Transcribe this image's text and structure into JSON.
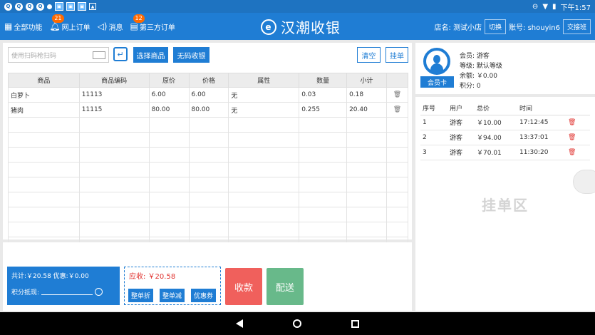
{
  "statusbar": {
    "time": "下午1:57"
  },
  "header": {
    "nav": [
      {
        "label": "全部功能",
        "badge": ""
      },
      {
        "label": "网上订单",
        "badge": "21"
      },
      {
        "label": "消息",
        "badge": ""
      },
      {
        "label": "第三方订单",
        "badge": "12"
      }
    ],
    "brand": "汉潮收银",
    "store_label": "店名: 测试小店",
    "switch_label": "切换",
    "account_label": "账号: shouyin6",
    "handover_label": "交接班"
  },
  "toolbar": {
    "scan_placeholder": "使用扫码枪扫码",
    "select_goods": "选择商品",
    "no_code": "无码收银",
    "clear": "清空",
    "hang": "挂单"
  },
  "goods_table": {
    "headers": [
      "商品",
      "商品编码",
      "原价",
      "价格",
      "属性",
      "数量",
      "小计"
    ],
    "rows": [
      [
        "白萝卜",
        "11113",
        "6.00",
        "6.00",
        "无",
        "0.03",
        "0.18"
      ],
      [
        "猪肉",
        "11115",
        "80.00",
        "80.00",
        "无",
        "0.255",
        "20.40"
      ]
    ]
  },
  "totals": {
    "summary": "共计:￥20.58  优惠:￥0.00",
    "points_label": "积分抵现:",
    "due": "应收: ￥20.58",
    "discount_btn": "整单折",
    "reduce_btn": "整单减",
    "coupon_btn": "优惠券",
    "pay": "收款",
    "deliver": "配送"
  },
  "member": {
    "card_btn": "会员卡",
    "name": "会员: 游客",
    "level": "等级: 默认等级",
    "balance": "余额: ￥0.00",
    "points": "积分: 0"
  },
  "pending": {
    "headers": [
      "序号",
      "用户",
      "总价",
      "时间"
    ],
    "rows": [
      [
        "1",
        "游客",
        "￥10.00",
        "17:12:45"
      ],
      [
        "2",
        "游客",
        "￥94.00",
        "13:37:01"
      ],
      [
        "3",
        "游客",
        "￥70.01",
        "11:30:20"
      ]
    ],
    "watermark": "挂单区"
  },
  "colors": {
    "primary": "#1f7dd4",
    "pay": "#f0605c",
    "deliver": "#68b98a",
    "due": "#e0332f"
  }
}
